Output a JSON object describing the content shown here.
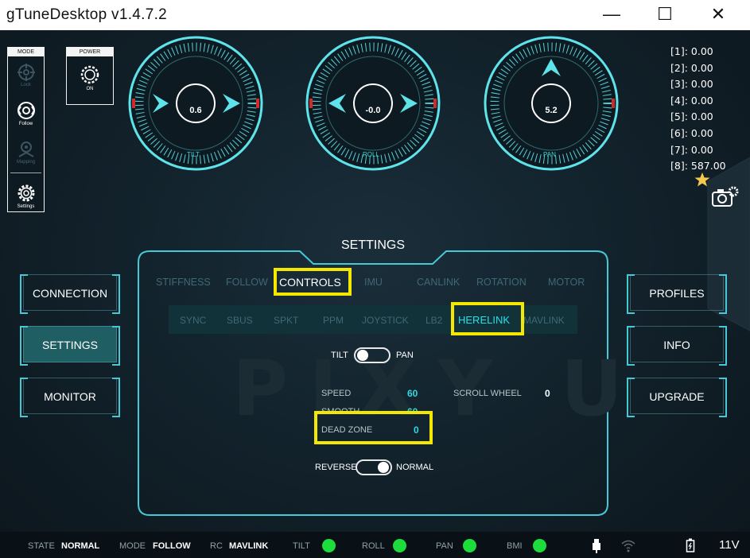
{
  "window": {
    "title": "gTuneDesktop  v1.4.7.2",
    "minimize": "—",
    "maximize": "☐",
    "close": "✕"
  },
  "mode_panel": {
    "header": "MODE",
    "items": [
      {
        "label": "Lock",
        "icon": "target-icon"
      },
      {
        "label": "Follow",
        "icon": "follow-icon"
      },
      {
        "label": "Mapping",
        "icon": "mapping-icon"
      },
      {
        "label": "Settings",
        "icon": "gear-icon"
      }
    ]
  },
  "power_panel": {
    "header": "POWER",
    "label": "ON",
    "icon": "power-icon"
  },
  "dials": [
    {
      "name": "TILT",
      "value": "0.6"
    },
    {
      "name": "ROLL",
      "value": "-0.0"
    },
    {
      "name": "PAN",
      "value": "5.2"
    }
  ],
  "channels": [
    "[1]: 0.00",
    "[2]: 0.00",
    "[3]: 0.00",
    "[4]: 0.00",
    "[5]: 0.00",
    "[6]: 0.00",
    "[7]: 0.00",
    "[8]: 587.00"
  ],
  "left_nav": [
    "CONNECTION",
    "SETTINGS",
    "MONITOR"
  ],
  "right_nav": [
    "PROFILES",
    "INFO",
    "UPGRADE"
  ],
  "settings": {
    "title": "SETTINGS",
    "tabs": [
      "STIFFNESS",
      "FOLLOW",
      "CONTROLS",
      "IMU",
      "CANLINK",
      "ROTATION",
      "MOTOR"
    ],
    "active_tab": "CONTROLS",
    "subtabs": [
      "SYNC",
      "SBUS",
      "SPKT",
      "PPM",
      "JOYSTICK",
      "LB2",
      "HERELINK",
      "MAVLINK"
    ],
    "active_subtab": "HERELINK",
    "axis_toggle": {
      "left": "TILT",
      "right": "PAN"
    },
    "speed": {
      "label": "SPEED",
      "value": "60"
    },
    "smooth": {
      "label": "SMOOTH",
      "value": "60"
    },
    "scroll_wheel": {
      "label": "SCROLL WHEEL",
      "value": "0"
    },
    "dead_zone": {
      "label": "DEAD ZONE",
      "value": "0"
    },
    "direction_toggle": {
      "left": "REVERSE",
      "right": "NORMAL"
    },
    "watermark": "PIXY U"
  },
  "status": {
    "state_label": "STATE",
    "state_value": "NORMAL",
    "mode_label": "MODE",
    "mode_value": "FOLLOW",
    "rc_label": "RC",
    "rc_value": "MAVLINK",
    "indicators": [
      "TILT",
      "ROLL",
      "PAN",
      "BMI"
    ],
    "voltage": "11V"
  },
  "colors": {
    "accent": "#3ad8d8",
    "highlight": "#f5e800",
    "ok": "#1ddd3c",
    "background": "#0f1c25"
  }
}
